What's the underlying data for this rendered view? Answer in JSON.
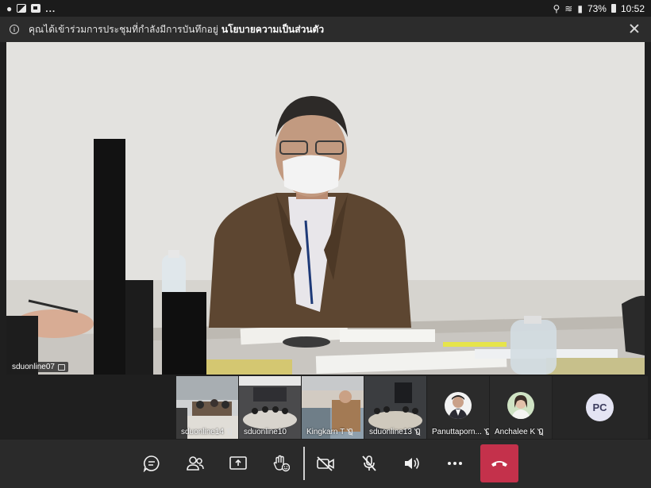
{
  "status_bar": {
    "overflow_indicator": "...",
    "battery": "73%",
    "time": "10:52"
  },
  "banner": {
    "text": "คุณได้เข้าร่วมการประชุมที่กำลังมีการบันทึกอยู่",
    "link": "นโยบายความเป็นส่วนตัว"
  },
  "main_video": {
    "participant": "sduonline07"
  },
  "thumbnails": [
    {
      "name": "sduonline14",
      "muted": true
    },
    {
      "name": "sduonline10",
      "muted": false
    },
    {
      "name": "Kingkarn T",
      "muted": true
    },
    {
      "name": "sduonline13",
      "muted": true
    },
    {
      "name": "Panuttaporn...",
      "muted": true
    },
    {
      "name": "Anchalee K",
      "muted": true
    }
  ],
  "extra_participant": {
    "initials": "PC"
  },
  "controls": {
    "icons": [
      "chat-icon",
      "participants-icon",
      "share-screen-icon",
      "raise-hand-icon",
      "camera-off-icon",
      "mic-off-icon",
      "speaker-icon",
      "more-icon",
      "hangup-icon"
    ]
  },
  "colors": {
    "hangup": "#c4314b",
    "background": "#1f1f1f",
    "banner": "#2c2c2c"
  }
}
